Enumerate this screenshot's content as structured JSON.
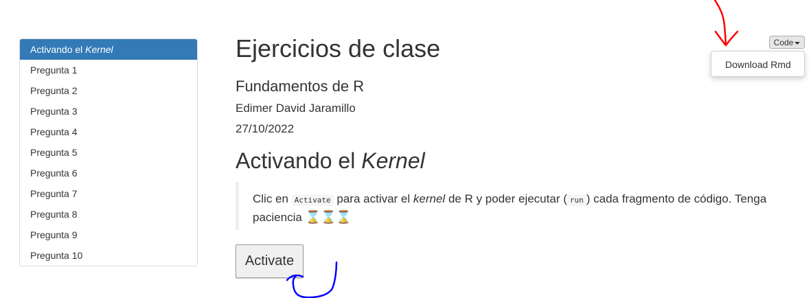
{
  "toc": {
    "items": [
      {
        "prefix": "Activando el ",
        "emph": "Kernel",
        "active": true
      },
      {
        "label": "Pregunta 1"
      },
      {
        "label": "Pregunta 2"
      },
      {
        "label": "Pregunta 3"
      },
      {
        "label": "Pregunta 4"
      },
      {
        "label": "Pregunta 5"
      },
      {
        "label": "Pregunta 6"
      },
      {
        "label": "Pregunta 7"
      },
      {
        "label": "Pregunta 8"
      },
      {
        "label": "Pregunta 9"
      },
      {
        "label": "Pregunta 10"
      }
    ]
  },
  "header": {
    "title": "Ejercicios de clase",
    "subtitle": "Fundamentos de R",
    "author": "Edimer David Jaramillo",
    "date": "27/10/2022"
  },
  "section": {
    "title_prefix": "Activando el ",
    "title_emph": "Kernel",
    "quote": {
      "t1": "Clic en ",
      "code1": "Activate",
      "t2": " para activar el ",
      "emph": "kernel",
      "t3": " de R y poder ejecutar (",
      "code2": "run",
      "t4": ") cada fragmento de código. Tenga paciencia ",
      "hourglasses": "⌛⌛⌛"
    },
    "button_label": "Activate"
  },
  "code_menu": {
    "button_label": "Code",
    "item": "Download Rmd"
  },
  "colors": {
    "active_bg": "#337ab7",
    "annotation_red": "#ff0000",
    "annotation_blue": "#0000ff"
  }
}
